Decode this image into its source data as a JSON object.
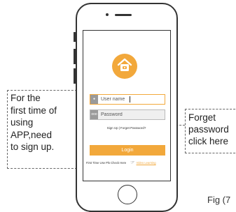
{
  "login_screen": {
    "username_placeholder": "User name",
    "username_icon": "user-icon",
    "password_placeholder": "Password",
    "password_icon": "lock-icon",
    "password_icon_label": "ooo",
    "sign_up": "Sign Up",
    "separator": "|",
    "forget_password": "Forget Password?",
    "login_label": "Login",
    "first_time_hint": "First Time Use Pls Check Here",
    "video_learning": "Video Learning",
    "hand_icon": "pointing-hand-icon",
    "logo_icon": "house-logo-icon"
  },
  "callouts": {
    "left": [
      "For the",
      "first time of",
      "using",
      "APP,need",
      "to sign up."
    ],
    "right": [
      "Forget",
      "password",
      "click here"
    ]
  },
  "figure_label": "Fig (7",
  "colors": {
    "accent": "#f2a83b",
    "outline": "#333333",
    "field_bg": "#efefef"
  }
}
